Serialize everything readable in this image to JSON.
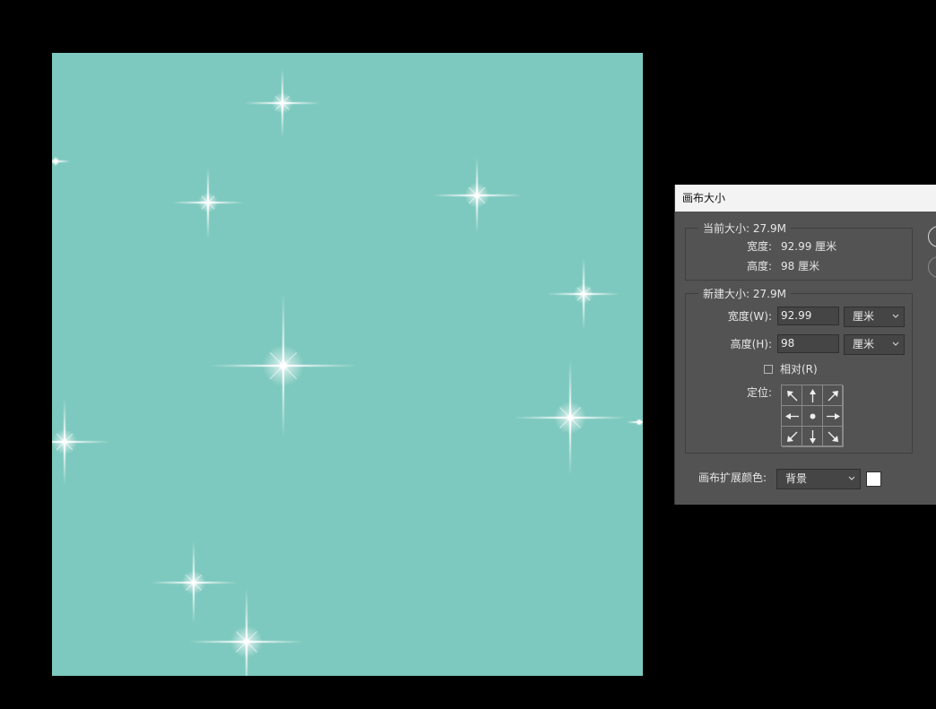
{
  "canvas": {
    "background_color": "#7ec9bf",
    "sparkle_color": "#ffffff"
  },
  "dialog": {
    "title": "画布大小",
    "current_size": {
      "legend": "当前大小: 27.9M",
      "width_label": "宽度:",
      "width_value": "92.99 厘米",
      "height_label": "高度:",
      "height_value": "98 厘米"
    },
    "new_size": {
      "legend": "新建大小: 27.9M",
      "width_label": "宽度(W):",
      "width_value": "92.99",
      "width_unit": "厘米",
      "height_label": "高度(H):",
      "height_value": "98",
      "height_unit": "厘米",
      "relative_label": "相对(R)",
      "relative_checked": false,
      "anchor_label": "定位:"
    },
    "extension_color_label": "画布扩展颜色:",
    "extension_color_value": "背景",
    "extension_color_swatch": "#ffffff"
  }
}
